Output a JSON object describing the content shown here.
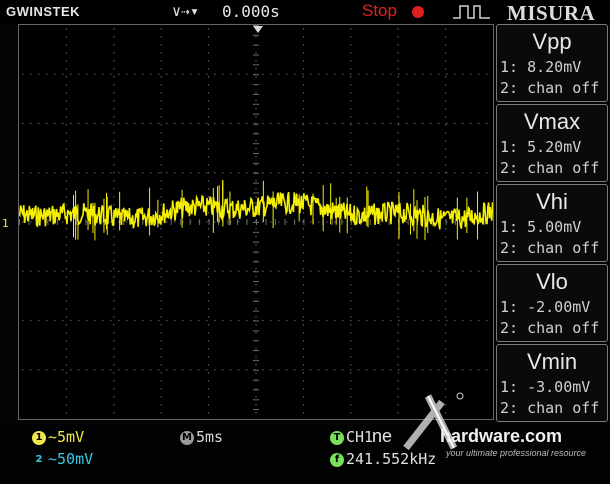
{
  "header": {
    "brand": "GWINSTEK",
    "trigger_symbols": "∨⇢▾",
    "trigger_value": "0.000s",
    "run_state": "Stop",
    "mode_label": "MISURA"
  },
  "measurements": [
    {
      "title": "Vpp",
      "ch1": "1: 8.20mV",
      "ch2": "2: chan off"
    },
    {
      "title": "Vmax",
      "ch1": "1: 5.20mV",
      "ch2": "2: chan off"
    },
    {
      "title": "Vhi",
      "ch1": "1: 5.00mV",
      "ch2": "2: chan off"
    },
    {
      "title": "Vlo",
      "ch1": "1: -2.00mV",
      "ch2": "2: chan off"
    },
    {
      "title": "Vmin",
      "ch1": "1: -3.00mV",
      "ch2": "2: chan off"
    }
  ],
  "footer": {
    "ch1_badge": "1",
    "ch1_scale": "~5mV",
    "ch2_badge": "2",
    "ch2_scale": "~50mV",
    "timebase_badge": "M",
    "timebase": "5ms",
    "trigger_badge": "T",
    "trigger_source": "CH1",
    "freq_badge": "f",
    "frequency": "241.552kHz"
  },
  "screen": {
    "ch1_marker": "1"
  },
  "watermark": {
    "site": "hardware.com",
    "prefix": "ne",
    "tagline": "your ultimate professional resource"
  },
  "colors": {
    "trace": "#f4f000",
    "stop": "#e02020",
    "ch1": "#f0e84a",
    "ch2": "#3cc8e6",
    "trigger": "#78e05a"
  }
}
